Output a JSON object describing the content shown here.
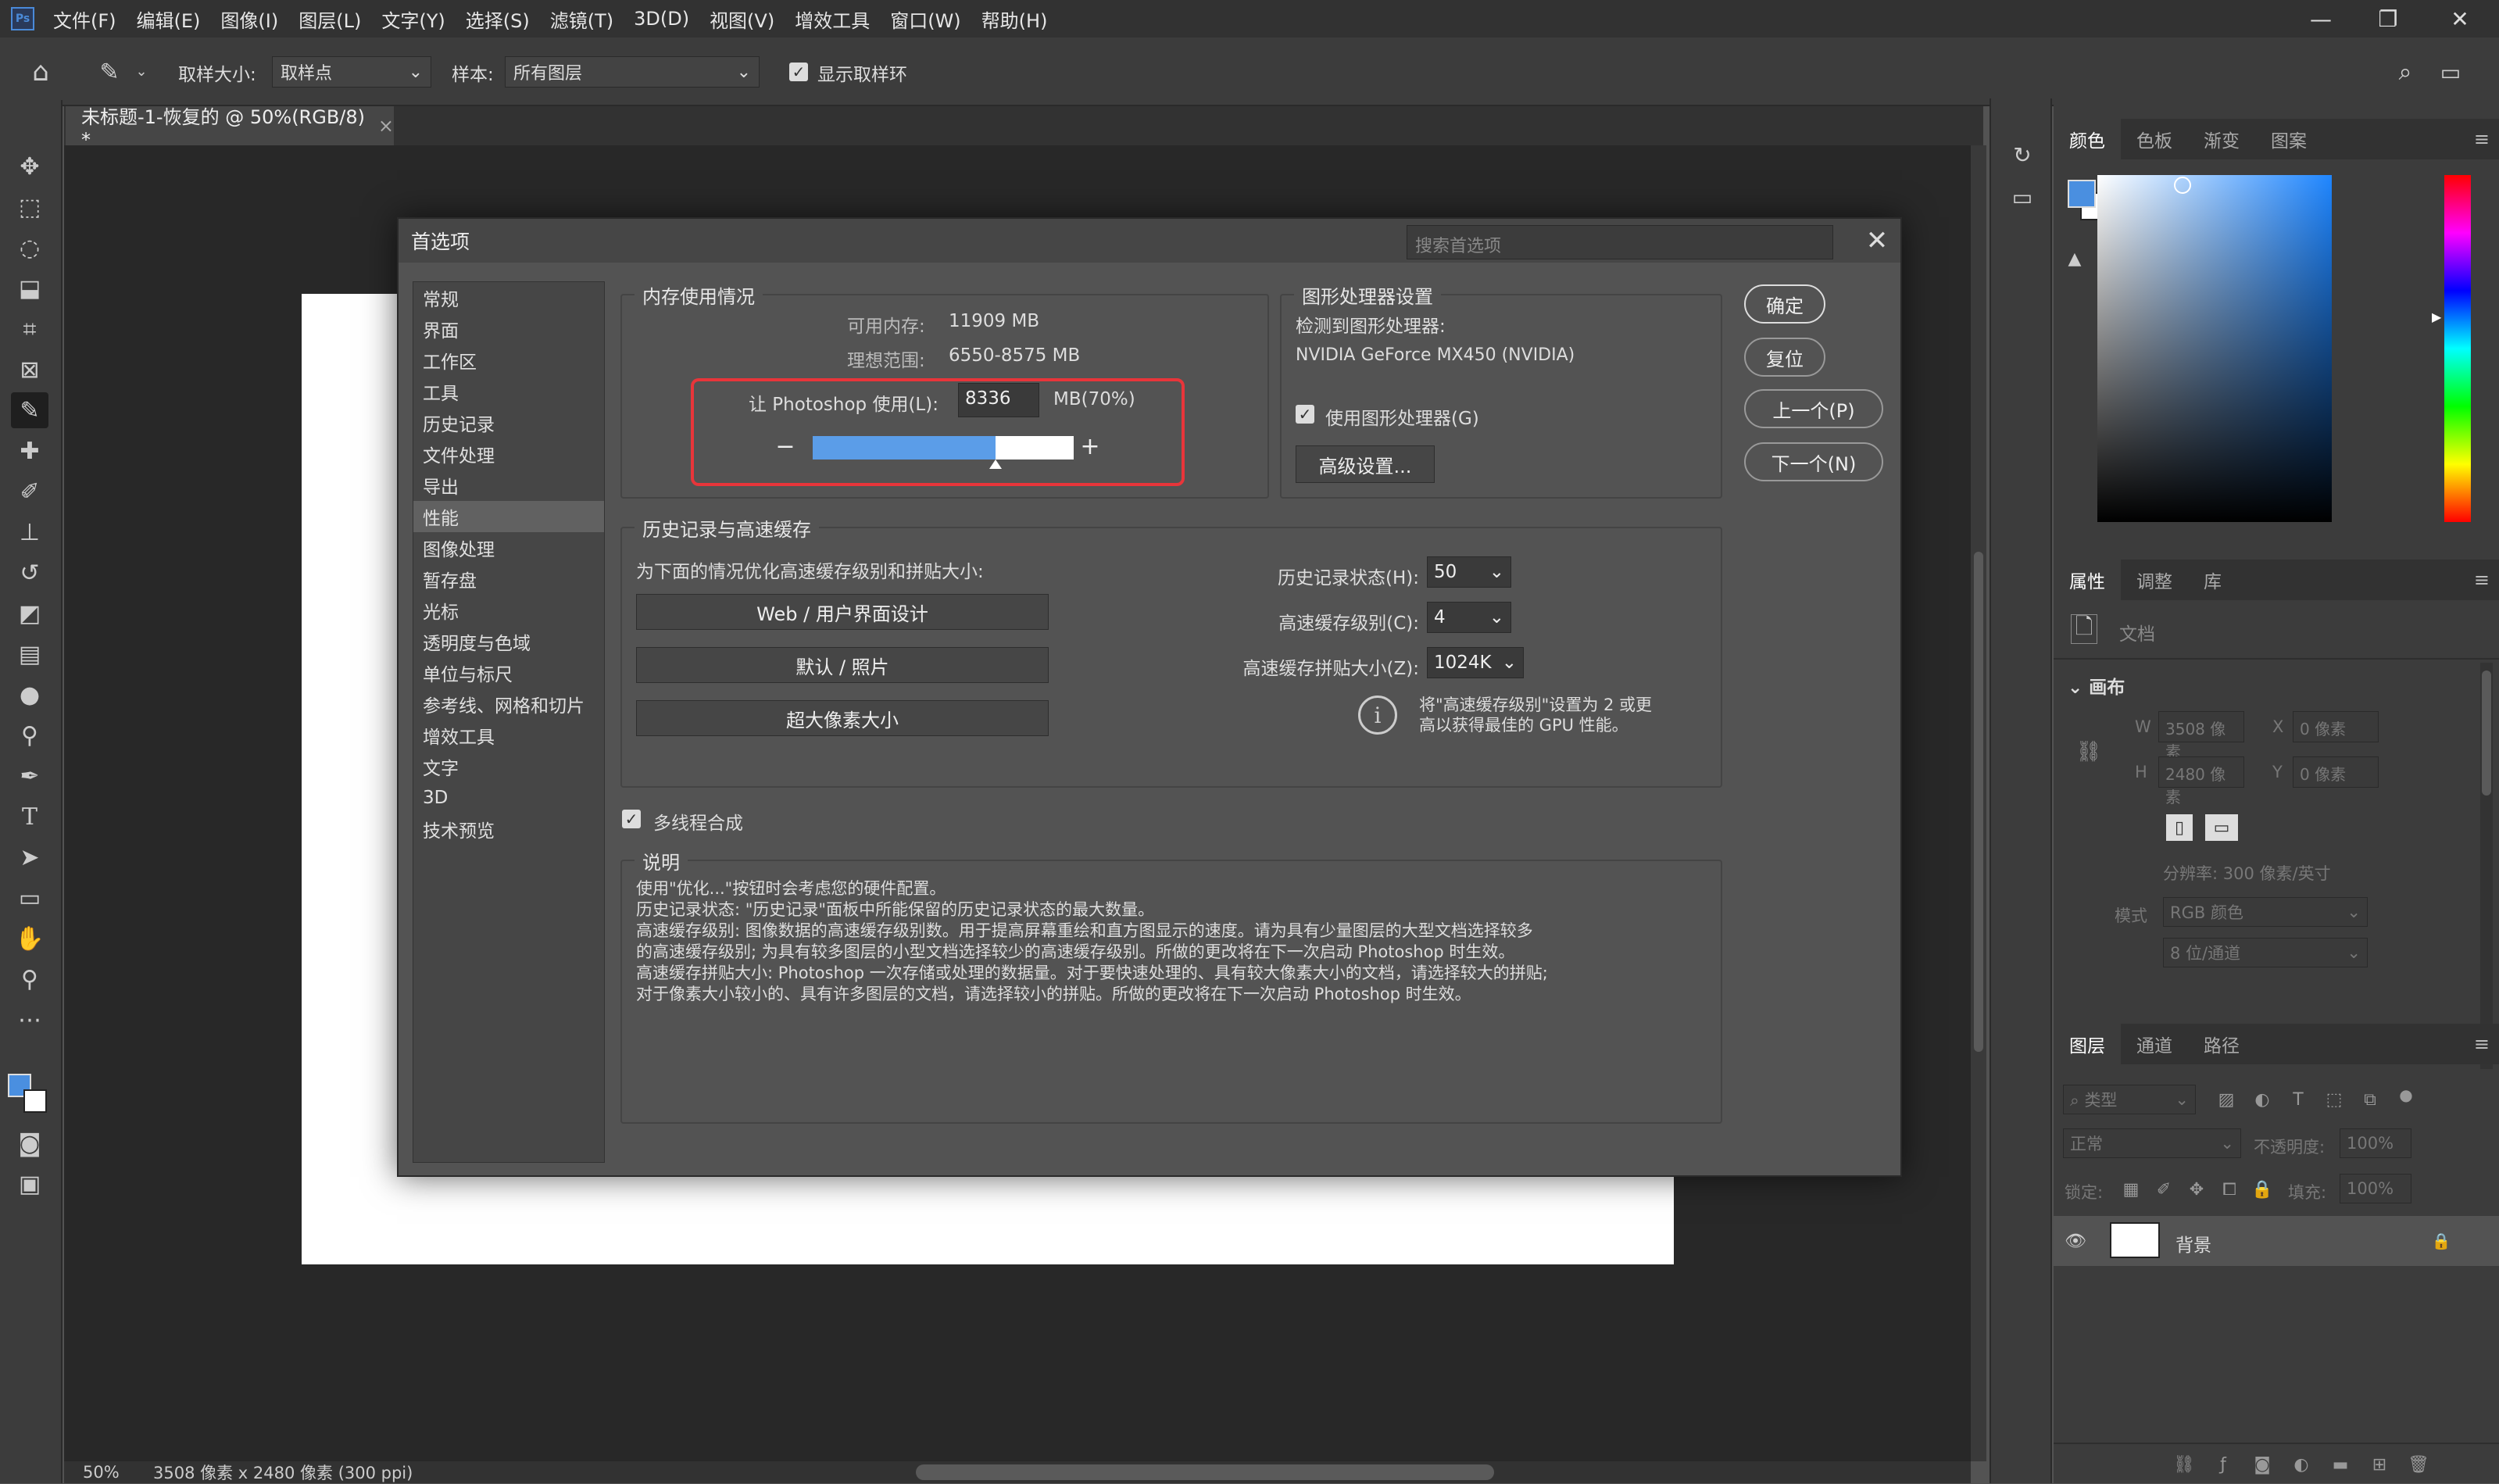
{
  "app": {
    "logo": "Ps",
    "menu": [
      "文件(F)",
      "编辑(E)",
      "图像(I)",
      "图层(L)",
      "文字(Y)",
      "选择(S)",
      "滤镜(T)",
      "3D(D)",
      "视图(V)",
      "增效工具",
      "窗口(W)",
      "帮助(H)"
    ]
  },
  "options": {
    "sample_size_label": "取样大小:",
    "sample_size_value": "取样点",
    "sample_label": "样本:",
    "sample_value": "所有图层",
    "show_ring_label": "显示取样环"
  },
  "document": {
    "tab_title": "未标题-1-恢复的 @ 50%(RGB/8) *",
    "close": "×"
  },
  "status": {
    "zoom": "50%",
    "info": "3508 像素 x 2480 像素 (300 ppi)"
  },
  "panels": {
    "color_tabs": [
      "颜色",
      "色板",
      "渐变",
      "图案"
    ],
    "props_tabs": [
      "属性",
      "调整",
      "库"
    ],
    "props": {
      "doc_label": "文档",
      "canvas_label": "画布",
      "w_label": "W",
      "w_value": "3508 像素",
      "x_label": "X",
      "x_value": "0 像素",
      "h_label": "H",
      "h_value": "2480 像素",
      "y_label": "Y",
      "y_value": "0 像素",
      "resolution": "分辨率: 300 像素/英寸",
      "mode_label": "模式",
      "mode_value": "RGB 颜色",
      "depth_value": "8 位/通道"
    },
    "layers_tabs": [
      "图层",
      "通道",
      "路径"
    ],
    "layers": {
      "filter_label": "类型",
      "blend": "正常",
      "opacity_label": "不透明度:",
      "opacity": "100%",
      "lock_label": "锁定:",
      "fill_label": "填充:",
      "fill": "100%",
      "layer_name": "背景"
    }
  },
  "dialog": {
    "title": "首选项",
    "search_placeholder": "搜索首选项",
    "close": "✕",
    "nav": [
      "常规",
      "界面",
      "工作区",
      "工具",
      "历史记录",
      "文件处理",
      "导出",
      "性能",
      "图像处理",
      "暂存盘",
      "光标",
      "透明度与色域",
      "单位与标尺",
      "参考线、网格和切片",
      "增效工具",
      "文字",
      "3D",
      "技术预览"
    ],
    "selected_nav": "性能",
    "memory": {
      "label": "内存使用情况",
      "available_label": "可用内存:",
      "available_value": "11909 MB",
      "ideal_label": "理想范围:",
      "ideal_value": "6550-8575 MB",
      "let_label": "让 Photoshop 使用(L):",
      "let_value": "8336",
      "let_unit": "MB(70%)",
      "minus": "−",
      "plus": "+",
      "slider_fraction": 0.7
    },
    "gpu": {
      "label": "图形处理器设置",
      "detected_label": "检测到图形处理器:",
      "gpu_name": "NVIDIA GeForce MX450 (NVIDIA)",
      "use_gpu_label": "使用图形处理器(G)",
      "advanced_button": "高级设置..."
    },
    "buttons": {
      "ok": "确定",
      "reset": "复位",
      "prev": "上一个(P)",
      "next": "下一个(N)"
    },
    "history": {
      "label": "历史记录与高速缓存",
      "optimize_label": "为下面的情况优化高速缓存级别和拼贴大小:",
      "btn_web": "Web / 用户界面设计",
      "btn_default": "默认 / 照片",
      "btn_huge": "超大像素大小",
      "states_label": "历史记录状态(H):",
      "states_value": "50",
      "levels_label": "高速缓存级别(C):",
      "levels_value": "4",
      "tile_label": "高速缓存拼贴大小(Z):",
      "tile_value": "1024K",
      "hint": [
        "将\"高速缓存级别\"设置为 2 或更",
        "高以获得最佳的 GPU 性能。"
      ]
    },
    "multithread_label": "多线程合成",
    "description": {
      "label": "说明",
      "lines": [
        "使用\"优化...\"按钮时会考虑您的硬件配置。",
        "历史记录状态: \"历史记录\"面板中所能保留的历史记录状态的最大数量。",
        "高速缓存级别: 图像数据的高速缓存级别数。用于提高屏幕重绘和直方图显示的速度。请为具有少量图层的大型文档选择较多",
        "的高速缓存级别; 为具有较多图层的小型文档选择较少的高速缓存级别。所做的更改将在下一次启动 Photoshop 时生效。",
        "高速缓存拼贴大小: Photoshop 一次存储或处理的数据量。对于要快速处理的、具有较大像素大小的文档，请选择较大的拼贴;",
        "对于像素大小较小的、具有许多图层的文档，请选择较小的拼贴。所做的更改将在下一次启动 Photoshop 时生效。"
      ]
    }
  },
  "colors": {
    "accent": "#4a90e2",
    "highlight": "#e8353a",
    "fg_color": "#4a8fe0"
  }
}
